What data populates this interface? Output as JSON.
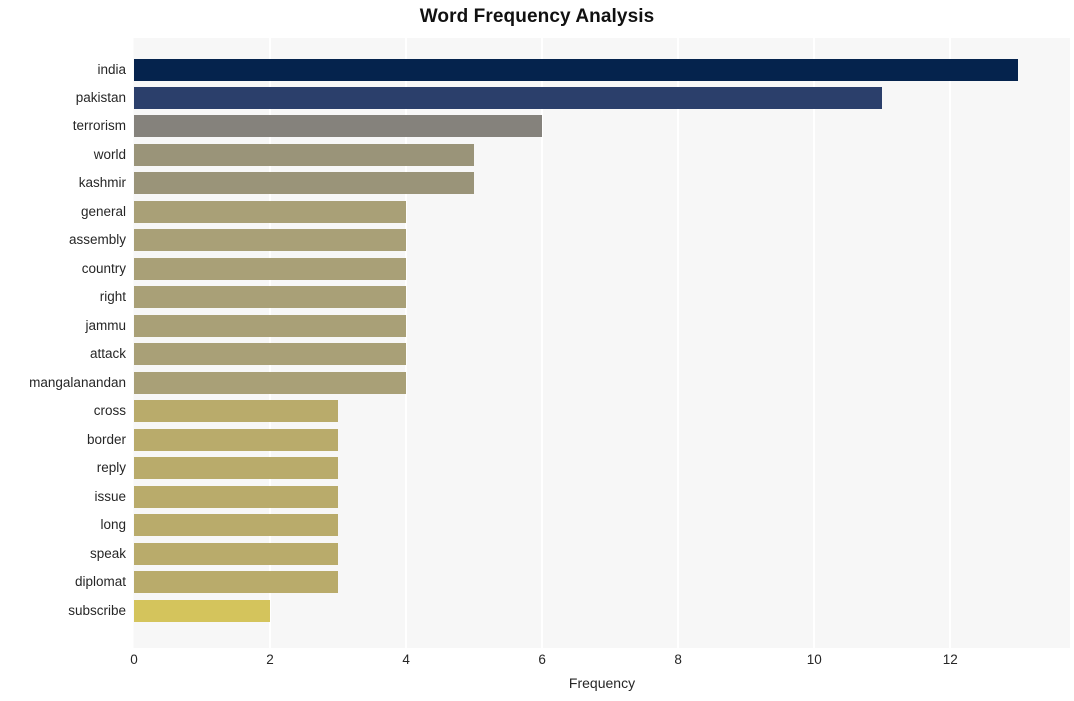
{
  "chart_data": {
    "type": "bar",
    "orientation": "horizontal",
    "title": "Word Frequency Analysis",
    "xlabel": "Frequency",
    "ylabel": "",
    "xlim": [
      0,
      13.76
    ],
    "xticks": [
      0,
      2,
      4,
      6,
      8,
      10,
      12
    ],
    "xticklabels": [
      "0",
      "2",
      "4",
      "6",
      "8",
      "10",
      "12"
    ],
    "grid": true,
    "grid_axis": "x",
    "legend": false,
    "plot_background": "#f7f7f7",
    "figure_background": "#ffffff",
    "categories": [
      "india",
      "pakistan",
      "terrorism",
      "world",
      "kashmir",
      "general",
      "assembly",
      "country",
      "right",
      "jammu",
      "attack",
      "mangalanandan",
      "cross",
      "border",
      "reply",
      "issue",
      "long",
      "speak",
      "diplomat",
      "subscribe"
    ],
    "values": [
      13,
      11,
      6,
      5,
      5,
      4,
      4,
      4,
      4,
      4,
      4,
      4,
      3,
      3,
      3,
      3,
      3,
      3,
      3,
      2
    ],
    "bar_colors": [
      "#05234d",
      "#2b3f6b",
      "#85827c",
      "#9a9479",
      "#9a9479",
      "#a9a077",
      "#a9a077",
      "#a9a077",
      "#a9a077",
      "#a9a077",
      "#a9a077",
      "#a9a077",
      "#b9ab6b",
      "#b9ab6b",
      "#b9ab6b",
      "#b9ab6b",
      "#b9ab6b",
      "#b9ab6b",
      "#b9ab6b",
      "#d4c45c"
    ]
  }
}
